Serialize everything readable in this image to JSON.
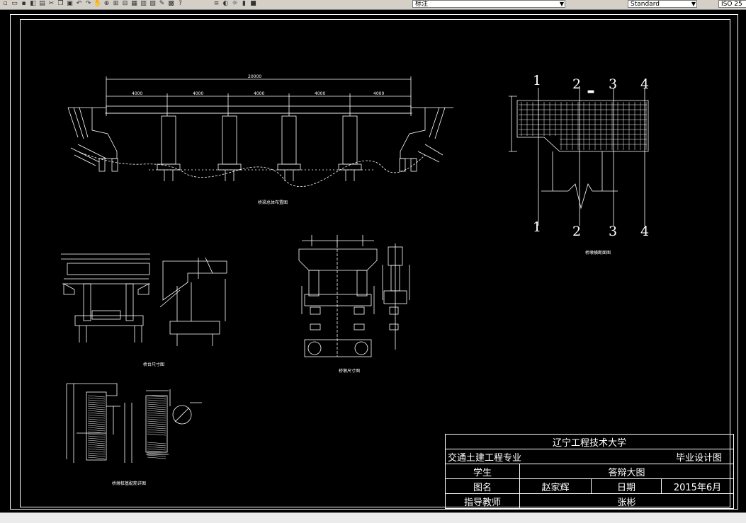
{
  "toolbar": {
    "layer_value": "标注",
    "style_value": "Standard",
    "right_label": "ISO 25",
    "icons": [
      "new-icon",
      "open-icon",
      "save-icon",
      "print-icon",
      "preview-icon",
      "cut-icon",
      "copy-icon",
      "paste-icon",
      "undo-icon",
      "redo-icon",
      "pan-icon",
      "zoom-realtime-icon",
      "zoom-window-icon",
      "zoom-previous-icon",
      "properties-icon",
      "designcenter-icon",
      "toolpalette-icon",
      "markup-icon",
      "calc-icon",
      "help-icon",
      "layer-manager-icon",
      "bulb-icon",
      "sun-icon",
      "lock-icon",
      "color-icon"
    ]
  },
  "drawing": {
    "captions": {
      "elevation": "桥梁总体布置图",
      "cross_section": "桥墩横断面图",
      "abutment": "桥台尺寸图",
      "pier": "桥墩尺寸图",
      "pile": "桥墩桩基配筋详图"
    },
    "dimensions": {
      "overall": "20000",
      "spans": [
        "4000",
        "4000",
        "4000",
        "4000",
        "4000"
      ]
    },
    "section_marks": [
      "1",
      "2",
      "3",
      "4"
    ]
  },
  "title_block": {
    "university": "辽宁工程技术大学",
    "major": "交通土建工程专业",
    "drawing_type": "毕业设计图",
    "student_label": "学生",
    "drawing_name": "答辩大图",
    "figure_label": "图名",
    "student_name": "赵家辉",
    "date_label": "日期",
    "date_value": "2015年6月",
    "advisor_label": "指导教师",
    "advisor_name": "张彬"
  }
}
